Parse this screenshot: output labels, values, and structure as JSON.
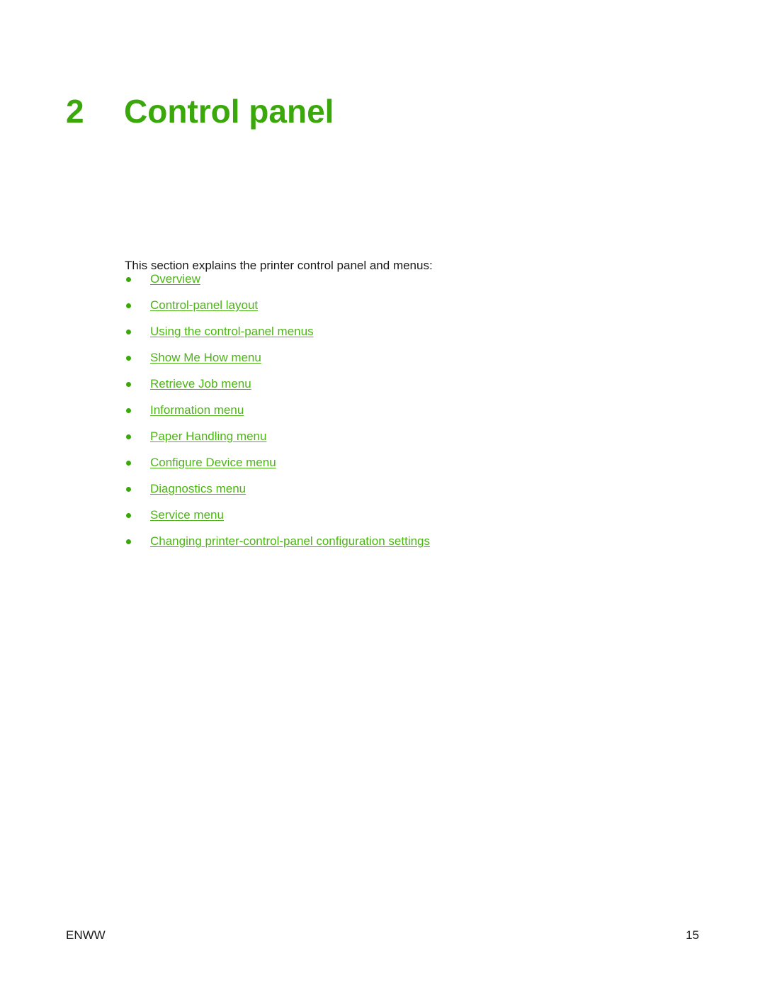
{
  "document": {
    "background_color": "#ffffff",
    "accent_color": "#3aa80a",
    "link_color": "#4cb515",
    "text_color": "#1a1a1a"
  },
  "chapter": {
    "number": "2",
    "title": "Control panel"
  },
  "intro": {
    "text": "This section explains the printer control panel and menus:"
  },
  "toc": {
    "items": [
      {
        "label": "Overview"
      },
      {
        "label": "Control-panel layout"
      },
      {
        "label": "Using the control-panel menus"
      },
      {
        "label": "Show Me How menu"
      },
      {
        "label": "Retrieve Job menu"
      },
      {
        "label": "Information menu"
      },
      {
        "label": "Paper Handling menu"
      },
      {
        "label": "Configure Device menu"
      },
      {
        "label": "Diagnostics menu"
      },
      {
        "label": "Service menu"
      },
      {
        "label": "Changing printer-control-panel configuration settings"
      }
    ]
  },
  "footer": {
    "locale": "ENWW",
    "page_number": "15"
  }
}
